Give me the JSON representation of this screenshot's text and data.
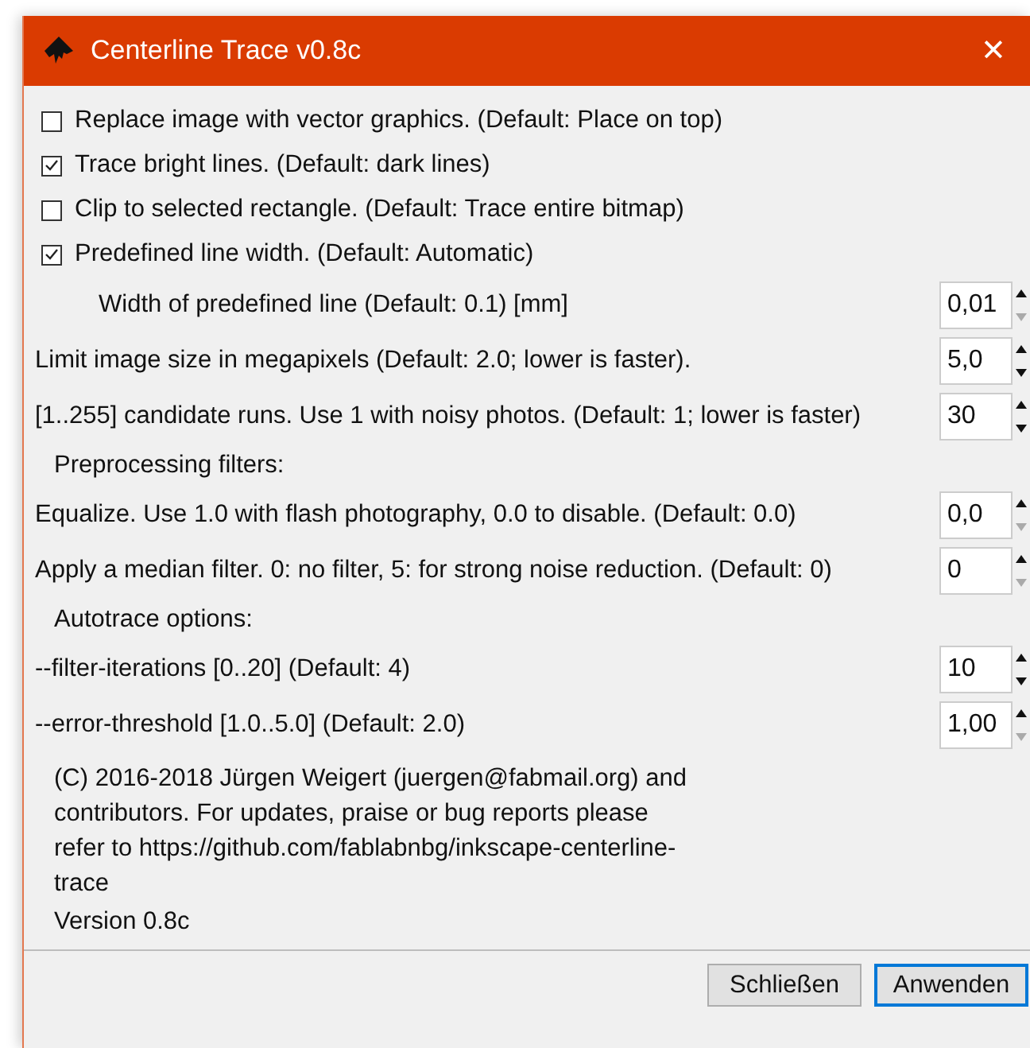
{
  "window": {
    "title": "Centerline Trace v0.8c",
    "close": "✕"
  },
  "rows": [
    {
      "kind": "checkbox",
      "label": "Replace image with vector graphics. (Default: Place on top)",
      "checked": false
    },
    {
      "kind": "checkbox",
      "label": "Trace bright lines. (Default: dark lines)",
      "checked": true
    },
    {
      "kind": "checkbox",
      "label": "Clip to selected rectangle. (Default: Trace entire bitmap)",
      "checked": false
    },
    {
      "kind": "checkbox",
      "label": "Predefined line width. (Default: Automatic)",
      "checked": true
    },
    {
      "kind": "subspin",
      "label": "Width of predefined line (Default: 0.1) [mm]",
      "value": "0,01",
      "down_disabled": true
    },
    {
      "kind": "spin",
      "label": "Limit image size in megapixels (Default: 2.0; lower is faster).",
      "value": "5,0",
      "down_disabled": false
    },
    {
      "kind": "spin",
      "label": "[1..255] candidate runs. Use 1 with noisy photos. (Default: 1; lower is faster)",
      "value": "30",
      "down_disabled": false
    },
    {
      "kind": "heading",
      "label": "Preprocessing filters:"
    },
    {
      "kind": "spin",
      "label": "Equalize. Use 1.0 with flash photography, 0.0 to disable. (Default: 0.0)",
      "value": "0,0",
      "down_disabled": true
    },
    {
      "kind": "spin",
      "label": "Apply a median filter. 0: no filter, 5: for strong noise reduction. (Default: 0)",
      "value": "0",
      "down_disabled": true
    },
    {
      "kind": "heading",
      "label": "Autotrace options:"
    },
    {
      "kind": "spin",
      "label": "--filter-iterations [0..20] (Default: 4)",
      "value": "10",
      "down_disabled": false
    },
    {
      "kind": "spin",
      "label": "--error-threshold [1.0..5.0] (Default: 2.0)",
      "value": "1,00",
      "down_disabled": true
    }
  ],
  "about": "(C) 2016-2018 Jürgen Weigert (juergen@fabmail.org) and contributors. For updates, praise or bug reports please refer to https://github.com/fablabnbg/inkscape-centerline-trace",
  "version": "Version 0.8c",
  "buttons": [
    {
      "label": "Schließen",
      "default": false
    },
    {
      "label": "Anwenden",
      "default": true
    }
  ]
}
